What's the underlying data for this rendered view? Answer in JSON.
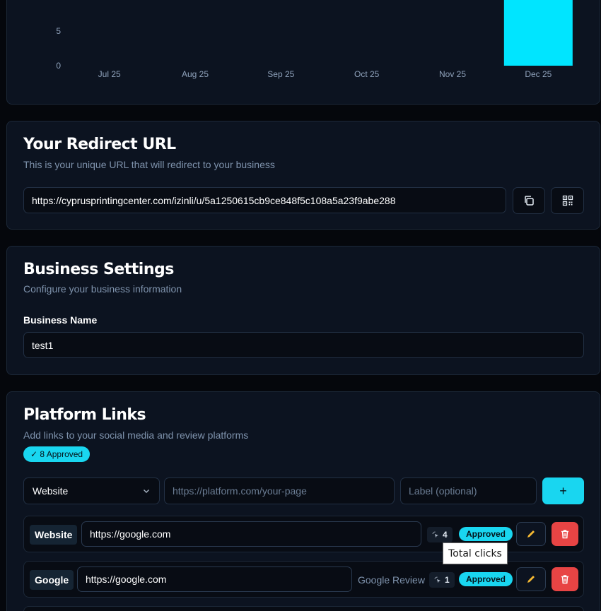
{
  "chart_data": {
    "type": "bar",
    "categories": [
      "Jul 25",
      "Aug 25",
      "Sep 25",
      "Oct 25",
      "Nov 25",
      "Dec 25"
    ],
    "values": [
      0,
      0,
      0,
      0,
      0,
      10
    ],
    "y_ticks": [
      "0",
      "5"
    ],
    "ylim": [
      0,
      10
    ],
    "bar_color": "#00e5ff",
    "grid": false
  },
  "redirect": {
    "title": "Your Redirect URL",
    "subtitle": "This is your unique URL that will redirect to your business",
    "url": "https://cyprusprintingcenter.com/izinli/u/5a1250615cb9ce848f5c108a5a23f9abe288",
    "copy_icon": "copy-icon",
    "qr_icon": "qr-code-icon"
  },
  "settings": {
    "title": "Business Settings",
    "subtitle": "Configure your business information",
    "name_label": "Business Name",
    "name_value": "test1"
  },
  "platform": {
    "title": "Platform Links",
    "subtitle": "Add links to your social media and review platforms",
    "approved_badge": "✓ 8 Approved",
    "select_value": "Website",
    "url_placeholder": "https://platform.com/your-page",
    "label_placeholder": "Label (optional)",
    "add_label": "+",
    "rows": [
      {
        "platform": "Website",
        "url": "https://google.com",
        "label": "",
        "clicks": "4",
        "status": "Approved"
      },
      {
        "platform": "Google",
        "url": "https://google.com",
        "label": "Google Review",
        "clicks": "1",
        "status": "Approved"
      }
    ]
  },
  "tooltip": {
    "text": "Total clicks"
  },
  "colors": {
    "accent": "#19d6f0",
    "danger": "#e84444",
    "edit": "#f5b932"
  }
}
